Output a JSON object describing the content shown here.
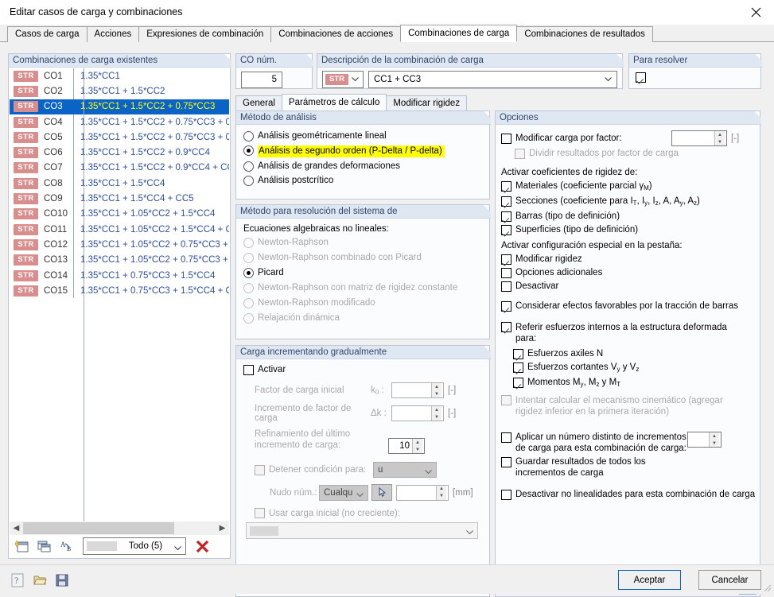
{
  "window": {
    "title": "Editar casos de carga y combinaciones",
    "close_icon": "close-icon"
  },
  "tabs": [
    {
      "label": "Casos de carga",
      "active": false
    },
    {
      "label": "Acciones",
      "active": false
    },
    {
      "label": "Expresiones de combinación",
      "active": false
    },
    {
      "label": "Combinaciones de acciones",
      "active": false
    },
    {
      "label": "Combinaciones de carga",
      "active": true
    },
    {
      "label": "Combinaciones de resultados",
      "active": false
    }
  ],
  "left_panel": {
    "title": "Combinaciones de carga existentes",
    "badge": "STR",
    "rows": [
      {
        "name": "CO1",
        "expr": "1.35*CC1",
        "selected": false
      },
      {
        "name": "CO2",
        "expr": "1.35*CC1 + 1.5*CC2",
        "selected": false
      },
      {
        "name": "CO3",
        "expr": "1.35*CC1 + 1.5*CC2 + 0.75*CC3",
        "selected": true
      },
      {
        "name": "CO4",
        "expr": "1.35*CC1 + 1.5*CC2 + 0.75*CC3 + 0",
        "selected": false
      },
      {
        "name": "CO5",
        "expr": "1.35*CC1 + 1.5*CC2 + 0.75*CC3 + 0",
        "selected": false
      },
      {
        "name": "CO6",
        "expr": "1.35*CC1 + 1.5*CC2 + 0.9*CC4",
        "selected": false
      },
      {
        "name": "CO7",
        "expr": "1.35*CC1 + 1.5*CC2 + 0.9*CC4 + CC",
        "selected": false
      },
      {
        "name": "CO8",
        "expr": "1.35*CC1 + 1.5*CC4",
        "selected": false
      },
      {
        "name": "CO9",
        "expr": "1.35*CC1 + 1.5*CC4 + CC5",
        "selected": false
      },
      {
        "name": "CO10",
        "expr": "1.35*CC1 + 1.05*CC2 + 1.5*CC4",
        "selected": false
      },
      {
        "name": "CO11",
        "expr": "1.35*CC1 + 1.05*CC2 + 1.5*CC4 + C",
        "selected": false
      },
      {
        "name": "CO12",
        "expr": "1.35*CC1 + 1.05*CC2 + 0.75*CC3 + ",
        "selected": false
      },
      {
        "name": "CO13",
        "expr": "1.35*CC1 + 1.05*CC2 + 0.75*CC3 + ",
        "selected": false
      },
      {
        "name": "CO14",
        "expr": "1.35*CC1 + 0.75*CC3 + 1.5*CC4",
        "selected": false
      },
      {
        "name": "CO15",
        "expr": "1.35*CC1 + 0.75*CC3 + 1.5*CC4 + C",
        "selected": false
      }
    ],
    "toolbar": {
      "new_icon": "new-combination-icon",
      "copy_icon": "copy-combination-icon",
      "rename_icon": "rename-combination-icon",
      "filter_value": "Todo (5)",
      "delete_icon": "delete-icon",
      "scroll_left_icon": "chevron-left-icon",
      "scroll_right_icon": "chevron-right-icon"
    }
  },
  "co_number": {
    "title": "CO núm.",
    "value": "5"
  },
  "description": {
    "title": "Descripción de la combinación de carga",
    "badge": "STR",
    "value": "CC1 + CC3"
  },
  "solve": {
    "title": "Para resolver",
    "checked": true
  },
  "inner_tabs": [
    {
      "label": "General",
      "active": false
    },
    {
      "label": "Parámetros de cálculo",
      "active": true
    },
    {
      "label": "Modificar rigidez",
      "active": false
    }
  ],
  "analysis_method": {
    "title": "Método de análisis",
    "options": [
      {
        "label": "Análisis geométricamente lineal",
        "selected": false,
        "highlighted": false
      },
      {
        "label": "Análisis de segundo orden (P-Delta / P-delta)",
        "selected": true,
        "highlighted": true
      },
      {
        "label": "Análisis de grandes deformaciones",
        "selected": false,
        "highlighted": false
      },
      {
        "label": "Análisis postcrítico",
        "selected": false,
        "highlighted": false
      }
    ]
  },
  "solver_method": {
    "title": "Método para resolución del sistema de",
    "subtitle": "Ecuaciones algebraicas no lineales:",
    "options": [
      {
        "label": "Newton-Raphson",
        "selected": false,
        "disabled": true
      },
      {
        "label": "Newton-Raphson combinado con Picard",
        "selected": false,
        "disabled": true
      },
      {
        "label": "Picard",
        "selected": true,
        "disabled": false
      },
      {
        "label": "Newton-Raphson con matriz de rigidez constante",
        "selected": false,
        "disabled": true
      },
      {
        "label": "Newton-Raphson modificado",
        "selected": false,
        "disabled": true
      },
      {
        "label": "Relajación dinámica",
        "selected": false,
        "disabled": true
      }
    ]
  },
  "incremental_load": {
    "title": "Carga incrementando gradualmente",
    "activate": {
      "label": "Activar",
      "checked": false
    },
    "initial_factor": {
      "label": "Factor de carga inicial",
      "symbol": "k",
      "sub": "0",
      "value": "",
      "unit": "[-]"
    },
    "factor_increment": {
      "label": "Incremento de factor de carga",
      "symbol": "Δk",
      "value": "",
      "unit": "[-]"
    },
    "refinement": {
      "label": "Refinamiento del último incremento de carga:",
      "value": "10"
    },
    "stop_condition": {
      "label": "Detener condición para:",
      "checked": false,
      "value": "u"
    },
    "node": {
      "label": "Nudo núm.:",
      "value": "Cualquie",
      "pick_icon": "pick-node-icon",
      "field_value": "",
      "unit": "[mm]"
    },
    "initial_load": {
      "label": "Usar carga inicial (no creciente):",
      "checked": false,
      "value": ""
    }
  },
  "options": {
    "title": "Opciones",
    "modify_load_factor": {
      "label": "Modificar carga por factor:",
      "checked": false,
      "value": "",
      "unit": "[-]"
    },
    "divide_results": {
      "label": "Dividir resultados por factor de carga",
      "checked": false,
      "disabled": true
    },
    "stiffness_header": "Activar coeficientes de rigidez de:",
    "stiffness_items": [
      {
        "label": "Materiales (coeficiente parcial γM)",
        "checked": true
      },
      {
        "label": "Secciones (coeficiente para IT, Iy, Iz, A, Ay, Az)",
        "checked": true
      },
      {
        "label": "Barras (tipo de definición)",
        "checked": true
      },
      {
        "label": "Superficies (tipo de definición)",
        "checked": true
      }
    ],
    "special_header": "Activar configuración especial en la pestaña:",
    "special_items": [
      {
        "label": "Modificar rigidez",
        "checked": true
      },
      {
        "label": "Opciones adicionales",
        "checked": false
      },
      {
        "label": "Desactivar",
        "checked": false
      }
    ],
    "favorable": {
      "label": "Considerar efectos favorables por la tracción de barras",
      "checked": true
    },
    "refer_internal": {
      "label": "Referir esfuerzos internos a la estructura deformada para:",
      "checked": true
    },
    "refer_items": [
      {
        "label": "Esfuerzos axiles N",
        "checked": true
      },
      {
        "label": "Esfuerzos cortantes Vy y Vz",
        "checked": true
      },
      {
        "label": "Momentos My, Mz y MT",
        "checked": true
      }
    ],
    "kinematic": {
      "label": "Intentar calcular el mecanismo cinemático (agregar rigidez inferior en la primera iteración)",
      "checked": false,
      "disabled": true
    },
    "distinct_increments": {
      "label": "Aplicar un número distinto de incrementos de carga para esta combinación de carga:",
      "checked": false,
      "value": ""
    },
    "save_results": {
      "label": "Guardar resultados de todos los incrementos de carga",
      "checked": false
    },
    "deactivate_nonlinear": {
      "label": "Desactivar no linealidades para esta combinación de carga",
      "checked": false
    },
    "lightning_icon": "lightning-settings-icon"
  },
  "footer": {
    "help_icon": "help-icon",
    "open_icon": "open-folder-icon",
    "save_icon": "save-icon",
    "accept_label": "Aceptar",
    "cancel_label": "Cancelar"
  }
}
